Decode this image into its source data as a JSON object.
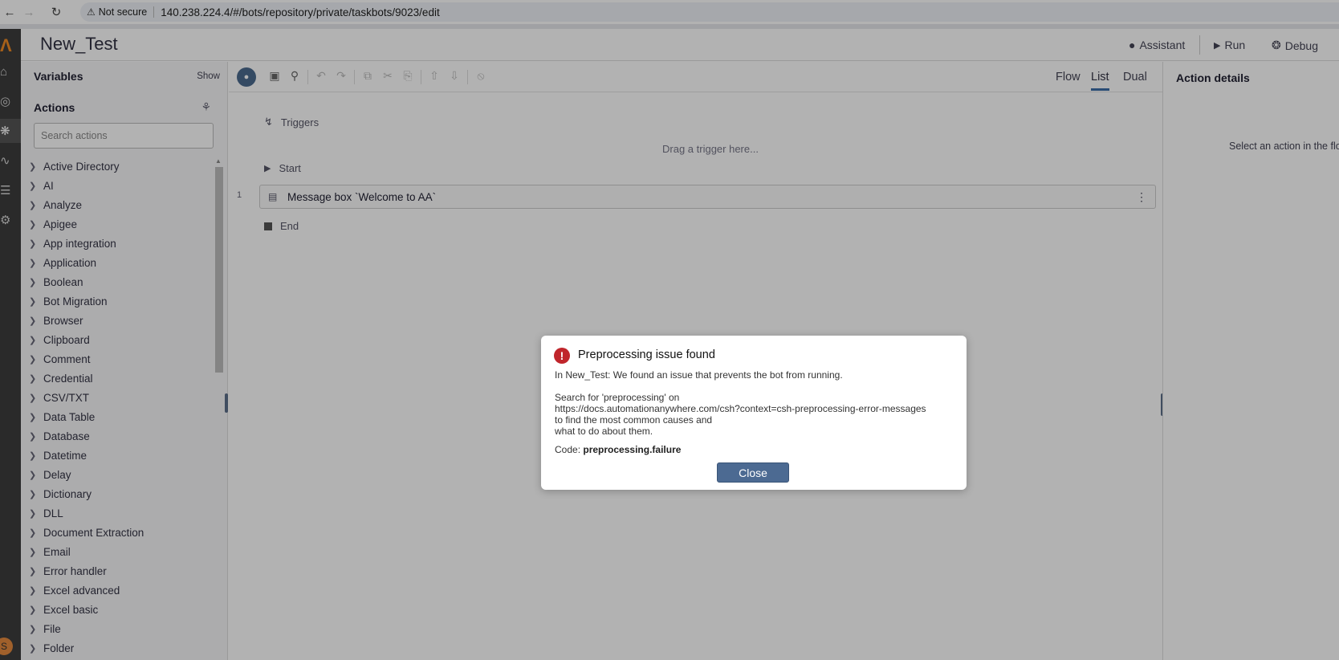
{
  "browser": {
    "security_label": "Not secure",
    "url": "140.238.224.4/#/bots/repository/private/taskbots/9023/edit"
  },
  "header": {
    "bot_name": "New_Test",
    "assistant_label": "Assistant",
    "run_label": "Run",
    "debug_label": "Debug"
  },
  "left_panel": {
    "variables_title": "Variables",
    "show_label": "Show",
    "actions_title": "Actions",
    "search_placeholder": "Search actions",
    "actions": [
      "Active Directory",
      "AI",
      "Analyze",
      "Apigee",
      "App integration",
      "Application",
      "Boolean",
      "Bot Migration",
      "Browser",
      "Clipboard",
      "Comment",
      "Credential",
      "CSV/TXT",
      "Data Table",
      "Database",
      "Datetime",
      "Delay",
      "Dictionary",
      "DLL",
      "Document Extraction",
      "Email",
      "Error handler",
      "Excel advanced",
      "Excel basic",
      "File",
      "Folder"
    ]
  },
  "canvas": {
    "view_tabs": [
      "Flow",
      "List",
      "Dual"
    ],
    "active_view": "List",
    "triggers_label": "Triggers",
    "drag_hint": "Drag a trigger here...",
    "start_label": "Start",
    "line_number": "1",
    "action_label": "Message box `Welcome to AA`",
    "end_label": "End"
  },
  "right_panel": {
    "title": "Action details",
    "hint": "Select an action in the flo"
  },
  "dialog": {
    "title": "Preprocessing issue found",
    "message": "In New_Test: We found an issue that prevents the bot from running.",
    "search_line": "Search for 'preprocessing' on",
    "docs_url": "https://docs.automationanywhere.com/csh?context=csh-preprocessing-error-messages",
    "causes_line": "to find the most common causes and",
    "todo_line": "what to do about them.",
    "code_prefix": "Code:",
    "code_value": "preprocessing.failure",
    "close_label": "Close"
  },
  "user": {
    "avatar_initial": "S"
  },
  "colors": {
    "accent": "#4c6a92",
    "error": "#c0252b",
    "rail": "#3d3d3d"
  }
}
